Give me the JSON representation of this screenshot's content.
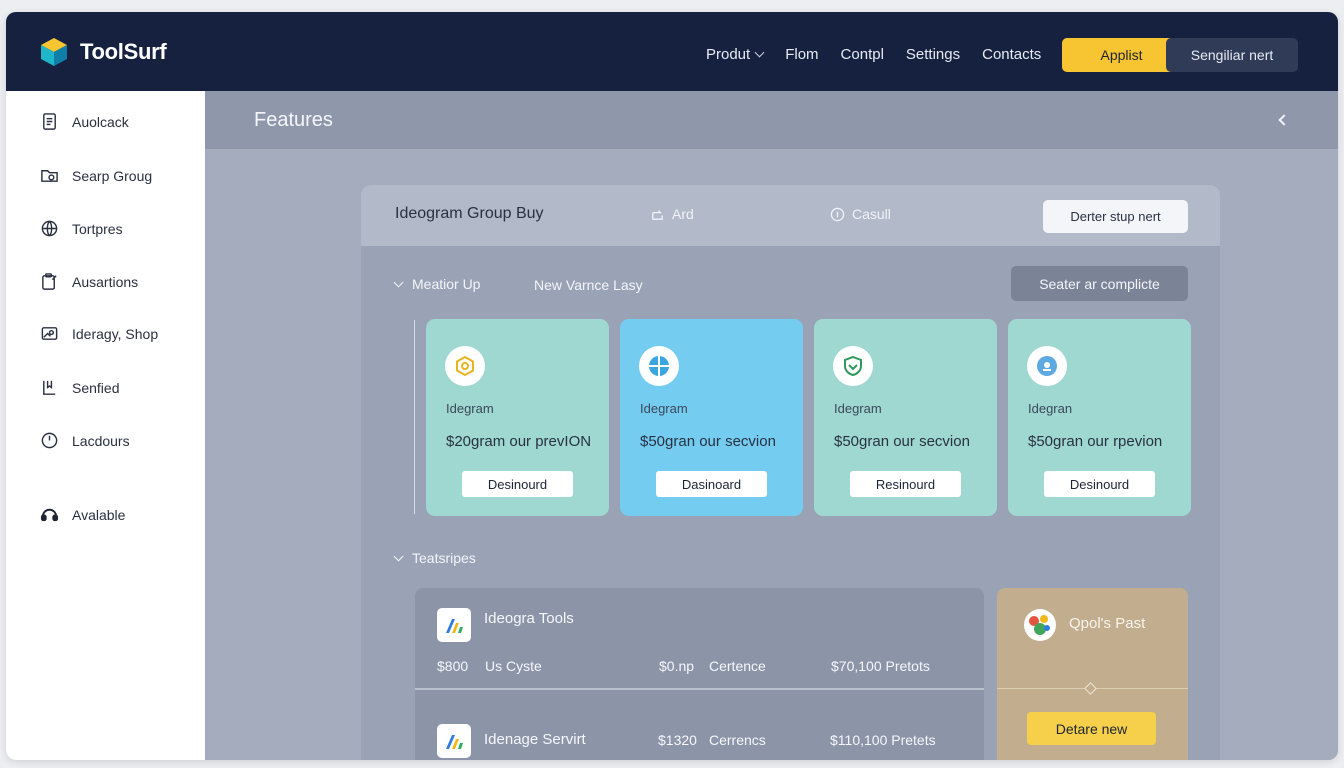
{
  "brand": {
    "name": "ToolSurf"
  },
  "nav": {
    "items": [
      {
        "label": "Produt",
        "has_dropdown": true
      },
      {
        "label": "Flom"
      },
      {
        "label": "Contpl"
      },
      {
        "label": "Settings"
      },
      {
        "label": "Contacts"
      }
    ],
    "primary_button": "Applist",
    "secondary_button": "Sengiliar nert"
  },
  "sidebar": {
    "items": [
      {
        "label": "Auolcack",
        "icon": "document-icon"
      },
      {
        "label": "Searp Groug",
        "icon": "folder-icon"
      },
      {
        "label": "Tortpres",
        "icon": "globe-icon"
      },
      {
        "label": "Ausartions",
        "icon": "clipboard-icon"
      },
      {
        "label": "Ideragy, Shop",
        "icon": "image-icon"
      },
      {
        "label": "Senfied",
        "icon": "bookmark-icon"
      },
      {
        "label": "Lacdours",
        "icon": "clock-icon"
      },
      {
        "label": "Avalable",
        "icon": "headset-icon"
      }
    ]
  },
  "main": {
    "title": "Features",
    "panel": {
      "title": "Ideogram Group Buy",
      "tab_1": "Ard",
      "tab_2": "Casull",
      "header_button": "Derter stup nert",
      "section_1": {
        "label": "Meatior Up",
        "aux_label": "New Varnce Lasy",
        "button": "Seater ar complicte"
      },
      "cards": [
        {
          "name": "Idegram",
          "price": "$20gram our prevION",
          "button": "Desinourd",
          "color": "#9ed8d1",
          "icon": "hexagon-icon"
        },
        {
          "name": "Idegram",
          "price": "$50gran our secvion",
          "button": "Dasinoard",
          "color": "#74cdf0",
          "icon": "globe-icon"
        },
        {
          "name": "Idegram",
          "price": "$50gran our secvion",
          "button": "Resinourd",
          "color": "#9ed8d1",
          "icon": "shield-icon"
        },
        {
          "name": "Idegran",
          "price": "$50gran our rpevion",
          "button": "Desinourd",
          "color": "#9ed8d1",
          "icon": "drop-icon"
        }
      ],
      "section_2": {
        "label": "Teatsripes"
      },
      "tools": [
        {
          "name": "Ideogra Tools",
          "col1": "$800",
          "col2": "Us Cyste",
          "col3": "$0.np",
          "col4": "Certence",
          "col5": "$70,100 Pretots"
        },
        {
          "name": "Idenage Servirt",
          "col1": "",
          "col2": "",
          "col3": "$1320",
          "col4": "Cerrencs",
          "col5": "$110,100 Pretets"
        }
      ],
      "promo": {
        "title": "Qpol's Past",
        "button": "Detare new"
      }
    }
  }
}
